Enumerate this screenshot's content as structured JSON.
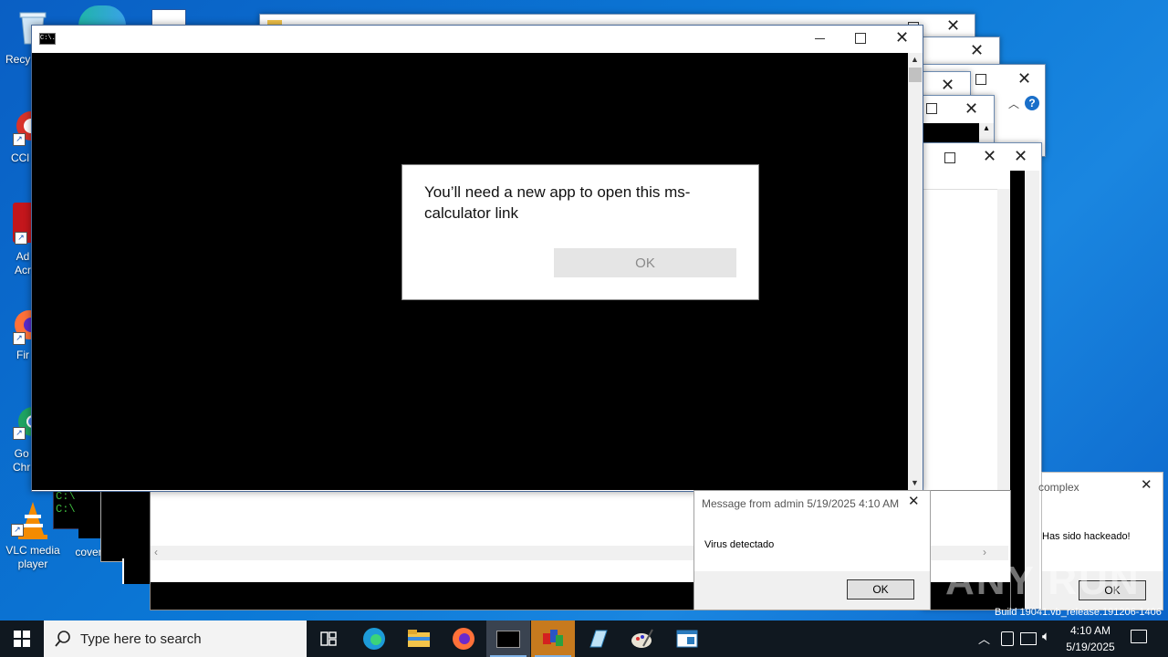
{
  "desktop": {
    "icons": [
      {
        "label": "Recy"
      },
      {
        "label": "CCl"
      },
      {
        "label": "Ad\nAcr"
      },
      {
        "label": "Fir"
      },
      {
        "label": "Go\nChr"
      },
      {
        "label": "VLC media\nplayer"
      },
      {
        "label": "cover"
      }
    ]
  },
  "cmd_window": {
    "icon_text": "C:\\."
  },
  "cmd_behind": {
    "lines": [
      "C:\\",
      "C:\\"
    ]
  },
  "app_dialog": {
    "message": "You’ll need a new app to open this ms-calculator link",
    "ok_label": "OK"
  },
  "message_box": {
    "title": "Message from admin 5/19/2025 4:10 AM",
    "body": "Virus detectado",
    "ok_label": "OK"
  },
  "complex_box": {
    "title": "complex",
    "body": "Has sido hackeado!",
    "ok_label": "OK"
  },
  "watermark": {
    "text": "ANY RUN",
    "build": "Build 19041.vb_release.191206-1406"
  },
  "taskbar": {
    "search_placeholder": "Type here to search",
    "clock_time": "4:10 AM",
    "clock_date": "5/19/2025"
  },
  "colors": {
    "desktop": "#0b78d6",
    "taskbar": "#101820",
    "accent": "#7fb2e6"
  }
}
